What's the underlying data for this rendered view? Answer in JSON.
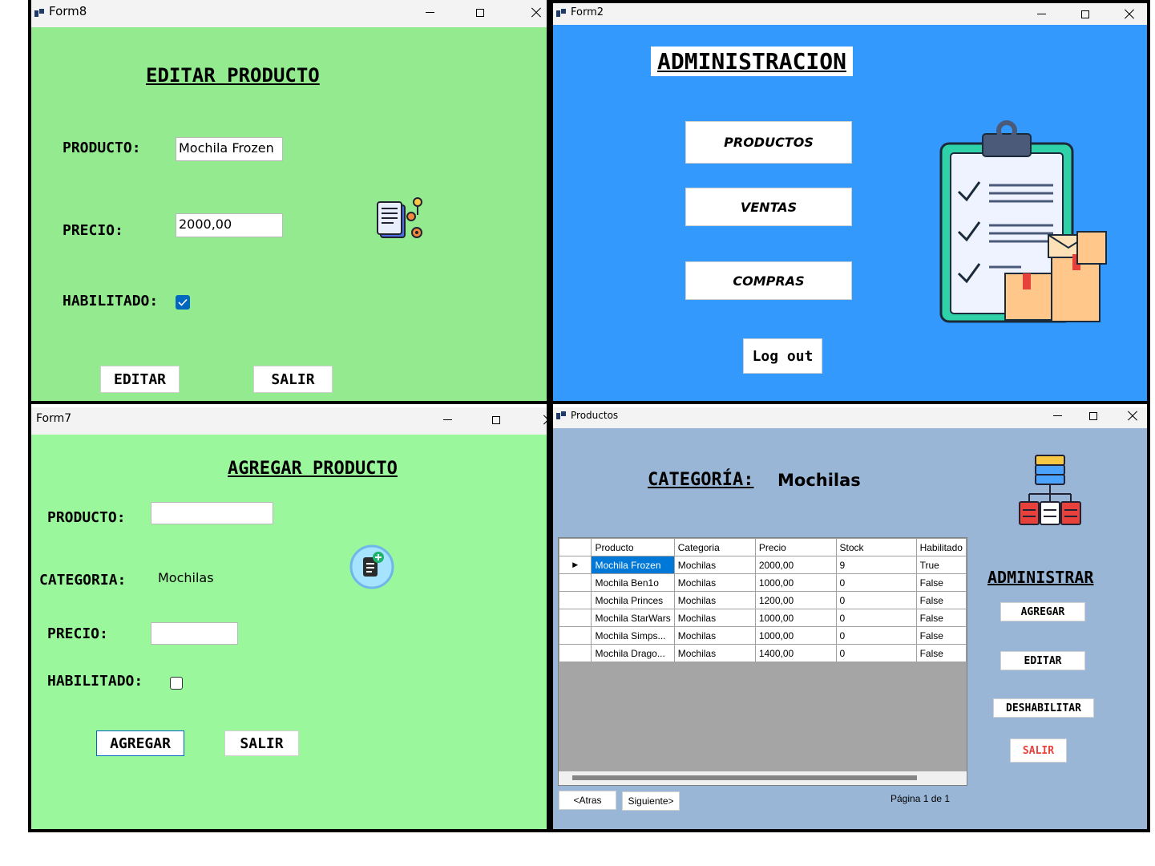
{
  "colors": {
    "form8_bg": "#93ea8f",
    "form2_bg": "#3499fd",
    "form7_bg": "#9bf79b",
    "productos_bg": "#9ab6d6"
  },
  "form8": {
    "title": "Form8",
    "heading": "EDITAR PRODUCTO",
    "producto_label": "PRODUCTO:",
    "producto_value": "Mochila Frozen",
    "precio_label": "PRECIO:",
    "precio_value": "2000,00",
    "habilitado_label": "HABILITADO:",
    "habilitado_checked": true,
    "editar_button": "EDITAR",
    "salir_button": "SALIR",
    "icon": "document-gears-icon"
  },
  "form2": {
    "title": "Form2",
    "heading": "ADMINISTRACION",
    "productos_button": "PRODUCTOS",
    "ventas_button": "VENTAS",
    "compras_button": "COMPRAS",
    "logout_button": "Log out",
    "illustration": "clipboard-checklist-boxes-icon"
  },
  "form7": {
    "title": "Form7",
    "heading": "AGREGAR PRODUCTO",
    "producto_label": "PRODUCTO:",
    "producto_value": "",
    "categoria_label": "CATEGORIA:",
    "categoria_value": "Mochilas",
    "precio_label": "PRECIO:",
    "precio_value": "",
    "habilitado_label": "HABILITADO:",
    "habilitado_checked": false,
    "agregar_button": "AGREGAR",
    "salir_button": "SALIR",
    "icon": "add-document-icon"
  },
  "productos": {
    "title": "Productos",
    "categoria_label": "CATEGORÍA:",
    "categoria_value": "Mochilas",
    "icon": "server-hierarchy-icon",
    "grid": {
      "columns": [
        "Producto",
        "Categoria",
        "Precio",
        "Stock",
        "Habilitado"
      ],
      "rows": [
        [
          "Mochila Frozen",
          "Mochilas",
          "2000,00",
          "9",
          "True"
        ],
        [
          "Mochila Ben1o",
          "Mochilas",
          "1000,00",
          "0",
          "False"
        ],
        [
          "Mochila Princes",
          "Mochilas",
          "1200,00",
          "0",
          "False"
        ],
        [
          "Mochila StarWars",
          "Mochilas",
          "1000,00",
          "0",
          "False"
        ],
        [
          "Mochila Simps...",
          "Mochilas",
          "1000,00",
          "0",
          "False"
        ],
        [
          "Mochila Drago...",
          "Mochilas",
          "1400,00",
          "0",
          "False"
        ]
      ],
      "selected_row": 0
    },
    "atras_button": "<Atras",
    "siguiente_button": "Siguiente>",
    "pagina_text": "Página 1 de 1",
    "administrar_heading": "ADMINISTRAR",
    "agregar_button": "AGREGAR",
    "editar_button": "EDITAR",
    "deshabilitar_button": "DESHABILITAR",
    "salir_button": "SALIR"
  }
}
